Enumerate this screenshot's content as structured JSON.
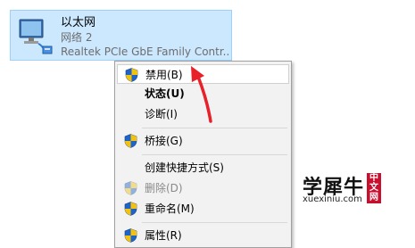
{
  "adapter": {
    "name": "以太网",
    "network": "网络 2",
    "device": "Realtek PCIe GbE Family Contr..."
  },
  "context_menu": {
    "items": [
      {
        "label": "禁用(B)",
        "icon": "uac-shield-icon",
        "highlighted": true,
        "bold": false,
        "disabled": false
      },
      {
        "label": "状态(U)",
        "icon": null,
        "highlighted": false,
        "bold": true,
        "disabled": false
      },
      {
        "label": "诊断(I)",
        "icon": null,
        "highlighted": false,
        "bold": false,
        "disabled": false
      },
      {
        "label": "桥接(G)",
        "icon": "uac-shield-icon",
        "highlighted": false,
        "bold": false,
        "disabled": false
      },
      {
        "label": "创建快捷方式(S)",
        "icon": null,
        "highlighted": false,
        "bold": false,
        "disabled": false
      },
      {
        "label": "删除(D)",
        "icon": "uac-shield-icon",
        "highlighted": false,
        "bold": false,
        "disabled": true
      },
      {
        "label": "重命名(M)",
        "icon": "uac-shield-icon",
        "highlighted": false,
        "bold": false,
        "disabled": false
      },
      {
        "label": "属性(R)",
        "icon": "uac-shield-icon",
        "highlighted": false,
        "bold": false,
        "disabled": false
      }
    ]
  },
  "watermark": {
    "main": "学犀牛",
    "seal": "中文网",
    "domain": "xuexiniu.com"
  },
  "colors": {
    "selection_bg": "#cce8ff",
    "selection_border": "#99d1ff",
    "menu_bg": "#f2f2f2",
    "arrow": "#e8202a",
    "shield_blue": "#1e64c8",
    "shield_yellow": "#f4c20d"
  }
}
